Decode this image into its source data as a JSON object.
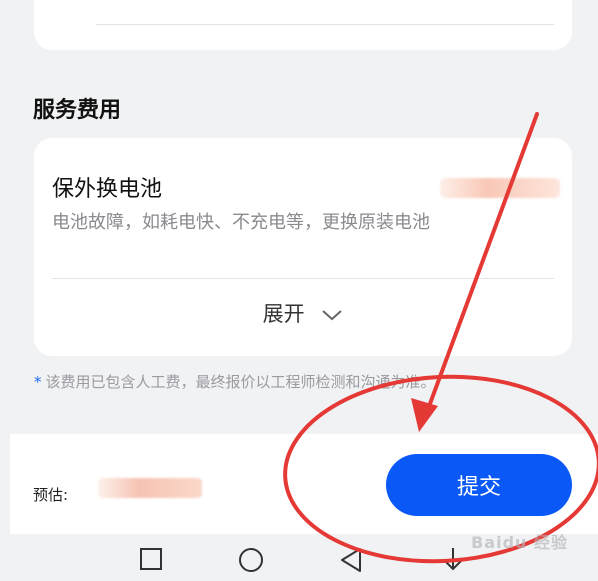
{
  "section": {
    "title": "服务费用"
  },
  "service_item": {
    "title": "保外换电池",
    "description": "电池故障，如耗电快、不充电等，更换原装电池",
    "expand_label": "展开"
  },
  "note": {
    "star": "*",
    "text": "该费用已包含人工费，最终报价以工程师检测和沟通为准。"
  },
  "bottom_bar": {
    "estimate_label": "预估:",
    "submit_label": "提交"
  },
  "annotation": {
    "color": "#e53935"
  },
  "navbar": {
    "icons": [
      "square-icon",
      "circle-icon",
      "back-triangle-icon",
      "download-icon"
    ]
  },
  "watermark": {
    "text": "Baidu 经验"
  }
}
